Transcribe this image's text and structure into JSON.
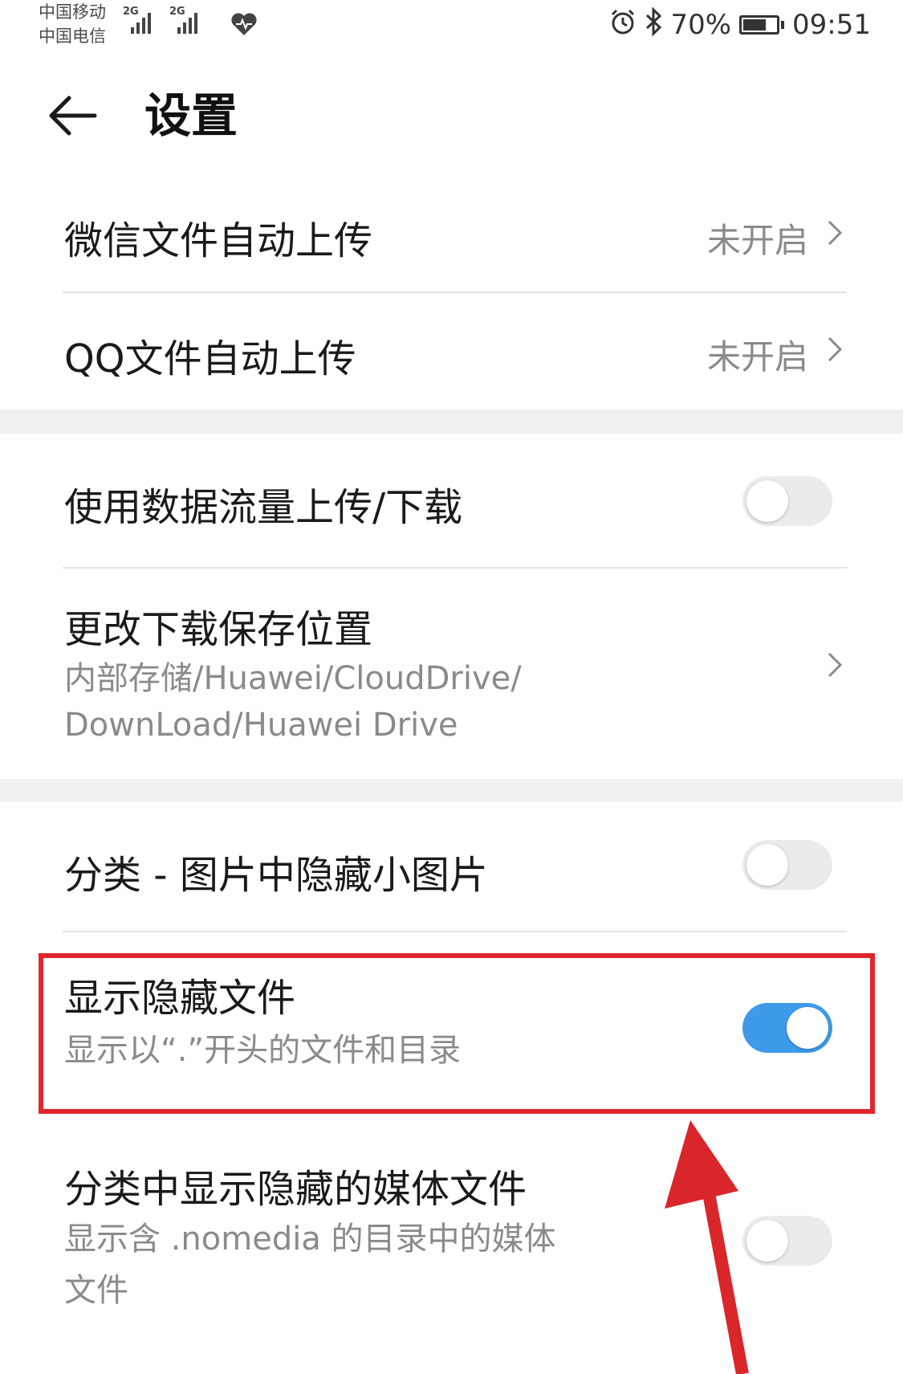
{
  "status_bar": {
    "carrier_1": "中国移动",
    "carrier_2": "中国电信",
    "network_1": "2G",
    "network_2": "2G",
    "battery_percent": "70%",
    "battery_level": 0.7,
    "time": "09:51",
    "icons": [
      "heart-icon",
      "alarm-icon",
      "bluetooth-icon",
      "battery-icon"
    ]
  },
  "header": {
    "back_icon": "arrow-left-icon",
    "title": "设置"
  },
  "settings": {
    "wechat_upload": {
      "label": "微信文件自动上传",
      "value": "未开启"
    },
    "qq_upload": {
      "label": "QQ文件自动上传",
      "value": "未开启"
    },
    "mobile_data": {
      "label": "使用数据流量上传/下载",
      "enabled": false
    },
    "download_location": {
      "label": "更改下载保存位置",
      "path_line_1": "内部存储/Huawei/CloudDrive/",
      "path_line_2": "DownLoad/Huawei Drive"
    },
    "hide_thumbnails": {
      "label": "分类 - 图片中隐藏小图片",
      "enabled": false
    },
    "show_hidden_files": {
      "label": "显示隐藏文件",
      "description": "显示以“.”开头的文件和目录",
      "enabled": true
    },
    "show_hidden_media": {
      "label": "分类中显示隐藏的媒体文件",
      "description_line_1": "显示含 .nomedia 的目录中的媒体",
      "description_line_2": "文件",
      "enabled": false
    }
  },
  "colors": {
    "toggle_on": "#3d9ae8",
    "toggle_off": "#ebebeb",
    "highlight": "#e0262b",
    "section_gap": "#f1f1f1"
  }
}
